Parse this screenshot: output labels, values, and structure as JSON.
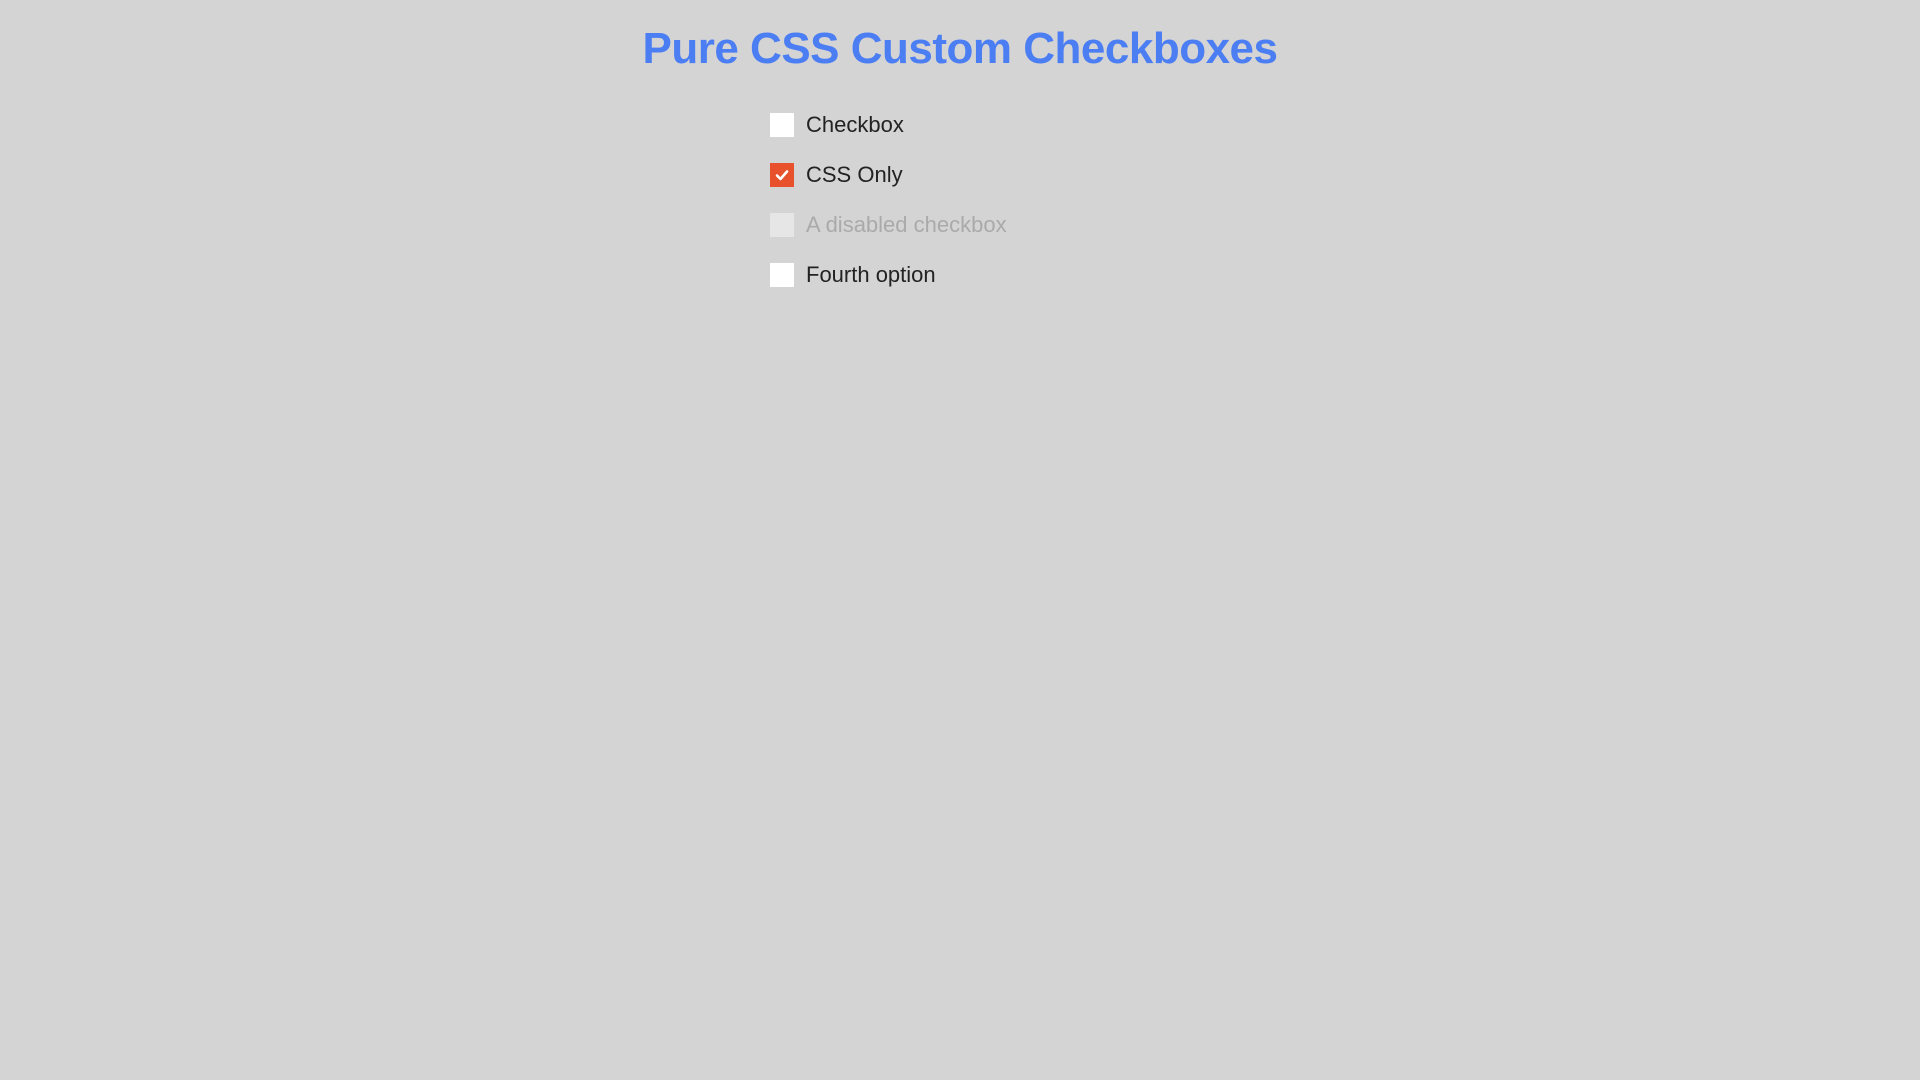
{
  "title": "Pure CSS Custom Checkboxes",
  "colors": {
    "heading": "#4c7ef3",
    "checked_bg": "#e7522c",
    "page_bg": "#d4d4d4"
  },
  "checkboxes": [
    {
      "label": "Checkbox",
      "checked": false,
      "disabled": false
    },
    {
      "label": "CSS Only",
      "checked": true,
      "disabled": false
    },
    {
      "label": "A disabled checkbox",
      "checked": false,
      "disabled": true
    },
    {
      "label": "Fourth option",
      "checked": false,
      "disabled": false
    }
  ]
}
